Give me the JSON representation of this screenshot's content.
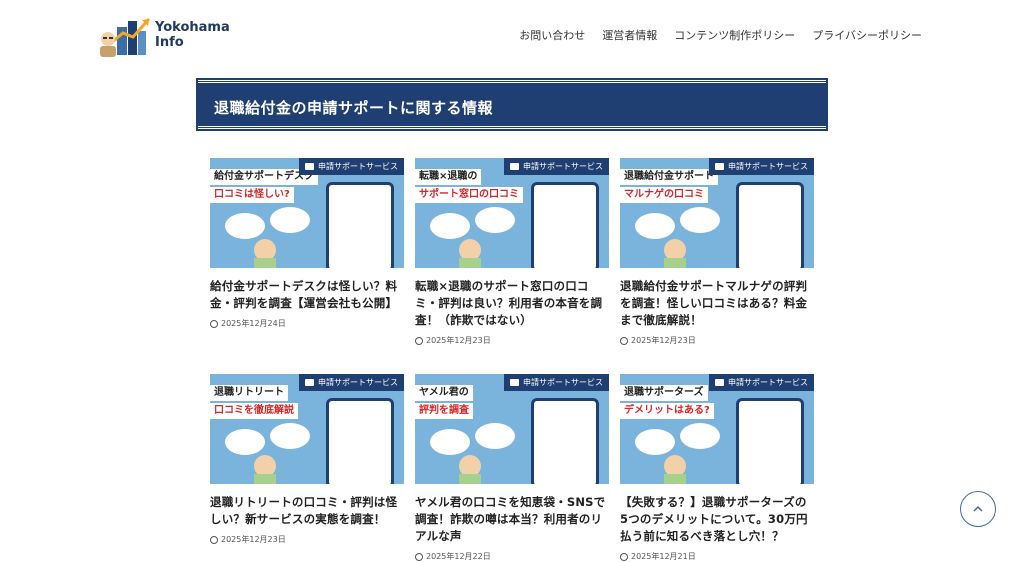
{
  "header": {
    "logo_text": "Yokohama Info",
    "nav": [
      "お問い合わせ",
      "運営者情報",
      "コンテンツ制作ポリシー",
      "プライバシーポリシー"
    ]
  },
  "page": {
    "title": "退職給付金の申請サポートに関する情報"
  },
  "category_label": "申請サポートサービス",
  "cards": [
    {
      "title": "給付金サポートデスクは怪しい？料金・評判を調査【運営会社も公開】",
      "date": "2025年12月24日",
      "thumb_lines": [
        "給付金サポートデスク",
        "口コミは怪しい?"
      ],
      "thumb_red": [
        false,
        true
      ]
    },
    {
      "title": "転職×退職のサポート窓口の口コミ・評判は良い？利用者の本音を調査！（詐欺ではない）",
      "date": "2025年12月23日",
      "thumb_lines": [
        "転職×退職の",
        "サポート窓口の口コミ"
      ],
      "thumb_red": [
        false,
        true
      ]
    },
    {
      "title": "退職給付金サポートマルナゲの評判を調査！怪しい口コミはある？料金まで徹底解説！",
      "date": "2025年12月23日",
      "thumb_lines": [
        "退職給付金サポート",
        "マルナゲの口コミ"
      ],
      "thumb_red": [
        false,
        true
      ]
    },
    {
      "title": "退職リトリートの口コミ・評判は怪しい？新サービスの実態を調査！",
      "date": "2025年12月23日",
      "thumb_lines": [
        "退職リトリート",
        "口コミを徹底解説"
      ],
      "thumb_red": [
        false,
        true
      ]
    },
    {
      "title": "ヤメル君の口コミを知恵袋・SNSで調査！詐欺の噂は本当？利用者のリアルな声",
      "date": "2025年12月22日",
      "thumb_lines": [
        "ヤメル君の",
        "評判を調査"
      ],
      "thumb_red": [
        false,
        true
      ]
    },
    {
      "title": "【失敗する？】退職サポーターズの5つのデメリットについて。30万円払う前に知るべき落とし穴！？",
      "date": "2025年12月21日",
      "thumb_lines": [
        "退職サポーターズ",
        "デメリットはある?"
      ],
      "thumb_red": [
        false,
        true
      ]
    }
  ]
}
